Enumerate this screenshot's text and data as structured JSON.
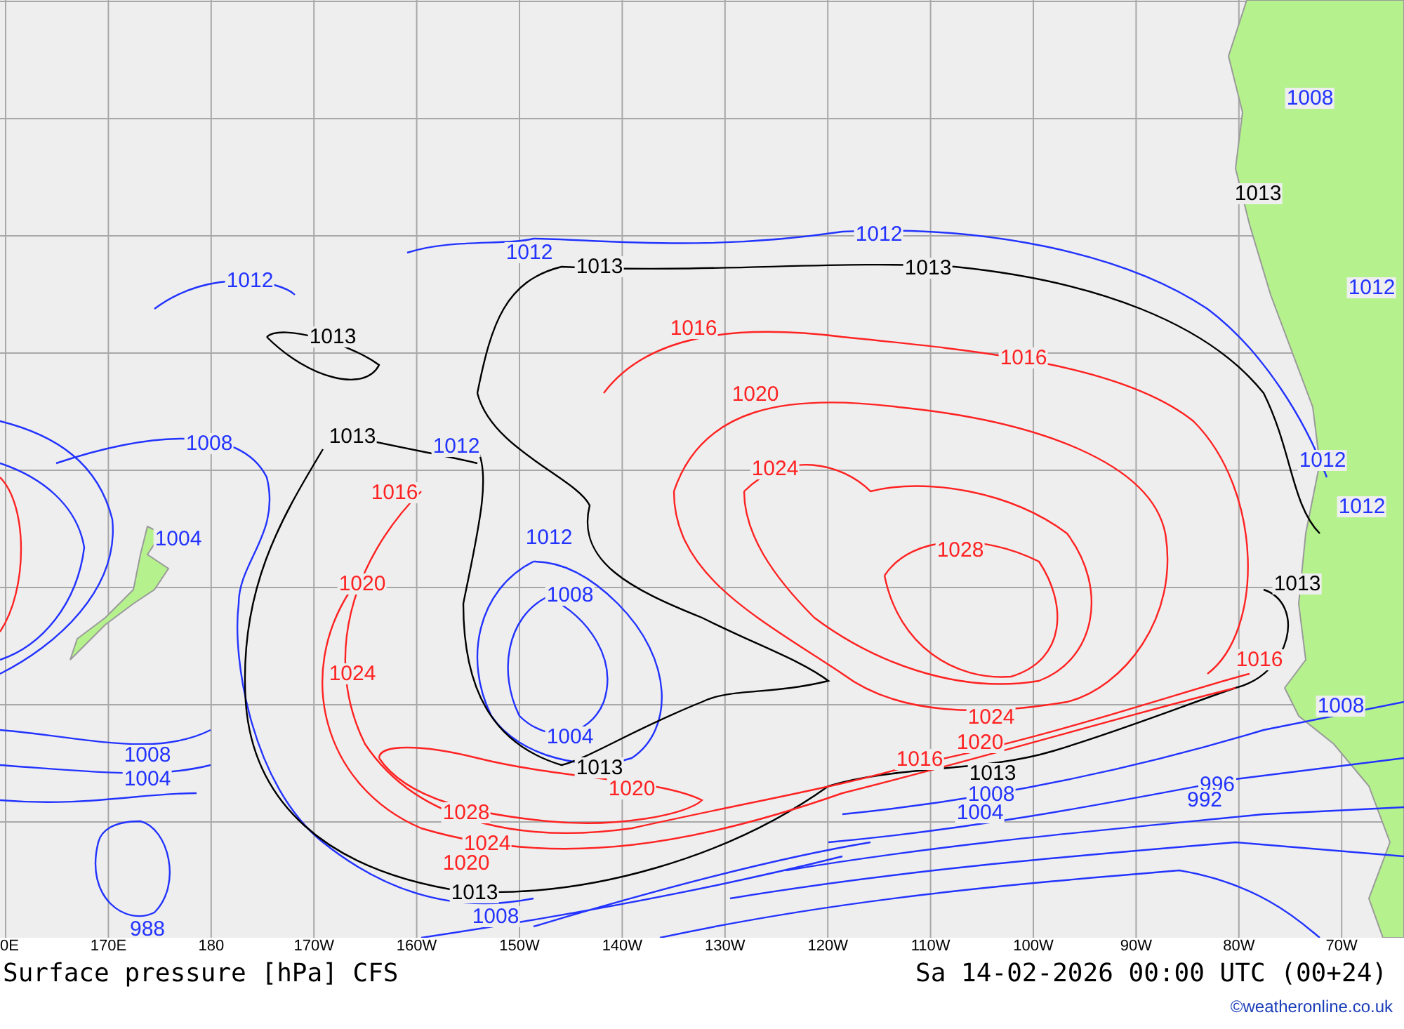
{
  "map": {
    "contour_labels": [
      {
        "text": "1012",
        "kind": "below"
      },
      {
        "text": "1012",
        "kind": "below"
      },
      {
        "text": "1012",
        "kind": "below"
      },
      {
        "text": "1008",
        "kind": "below"
      },
      {
        "text": "1012",
        "kind": "below"
      },
      {
        "text": "1008",
        "kind": "below"
      },
      {
        "text": "1004",
        "kind": "below"
      },
      {
        "text": "1012",
        "kind": "below"
      },
      {
        "text": "1012",
        "kind": "below"
      },
      {
        "text": "1008",
        "kind": "below"
      },
      {
        "text": "1004",
        "kind": "below"
      },
      {
        "text": "1012",
        "kind": "below"
      },
      {
        "text": "1012",
        "kind": "below"
      },
      {
        "text": "1008",
        "kind": "below"
      },
      {
        "text": "1004",
        "kind": "below"
      },
      {
        "text": "1008",
        "kind": "below"
      },
      {
        "text": "996",
        "kind": "below"
      },
      {
        "text": "992",
        "kind": "below"
      },
      {
        "text": "1008",
        "kind": "below"
      },
      {
        "text": "1004",
        "kind": "below"
      },
      {
        "text": "1008",
        "kind": "below"
      },
      {
        "text": "988",
        "kind": "below"
      },
      {
        "text": "1013",
        "kind": "reference"
      },
      {
        "text": "1013",
        "kind": "reference"
      },
      {
        "text": "1013",
        "kind": "reference"
      },
      {
        "text": "1013",
        "kind": "reference"
      },
      {
        "text": "1013",
        "kind": "reference"
      },
      {
        "text": "1013",
        "kind": "reference"
      },
      {
        "text": "1013",
        "kind": "reference"
      },
      {
        "text": "1013",
        "kind": "reference"
      },
      {
        "text": "1013",
        "kind": "reference"
      },
      {
        "text": "1016",
        "kind": "above"
      },
      {
        "text": "1016",
        "kind": "above"
      },
      {
        "text": "1020",
        "kind": "above"
      },
      {
        "text": "1024",
        "kind": "above"
      },
      {
        "text": "1028",
        "kind": "above"
      },
      {
        "text": "1016",
        "kind": "above"
      },
      {
        "text": "1020",
        "kind": "above"
      },
      {
        "text": "1024",
        "kind": "above"
      },
      {
        "text": "1024",
        "kind": "above"
      },
      {
        "text": "1020",
        "kind": "above"
      },
      {
        "text": "1016",
        "kind": "above"
      },
      {
        "text": "1020",
        "kind": "above"
      },
      {
        "text": "1028",
        "kind": "above"
      },
      {
        "text": "1024",
        "kind": "above"
      },
      {
        "text": "1016",
        "kind": "above"
      },
      {
        "text": "1020",
        "kind": "above"
      }
    ],
    "longitude_labels": [
      "0E",
      "170E",
      "180",
      "170W",
      "160W",
      "150W",
      "140W",
      "130W",
      "120W",
      "110W",
      "100W",
      "90W",
      "80W",
      "70W"
    ]
  },
  "title": "Surface pressure [hPa] CFS",
  "valid_time": "Sa 14-02-2026 00:00 UTC (00+24)",
  "credit": "©weatheronline.co.uk"
}
